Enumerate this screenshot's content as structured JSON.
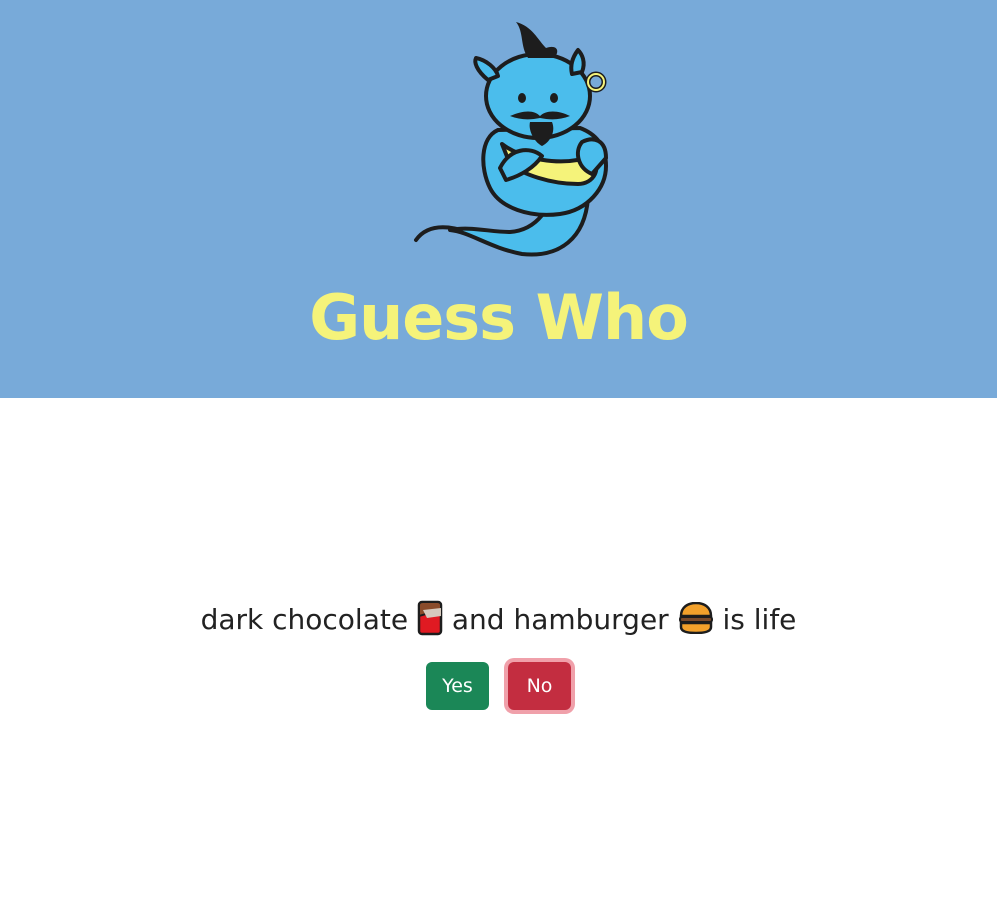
{
  "header": {
    "title": "Guess Who",
    "background_color": "#78aad9",
    "title_color": "#f5f37a",
    "logo_icon": "genie-icon"
  },
  "question": {
    "text_before": "dark chocolate",
    "emoji_1": "chocolate-bar-icon",
    "text_middle": "and hamburger",
    "emoji_2": "hamburger-icon",
    "text_after": "is life"
  },
  "buttons": {
    "yes_label": "Yes",
    "no_label": "No",
    "yes_color": "#1b8757",
    "no_color": "#c32d40"
  }
}
